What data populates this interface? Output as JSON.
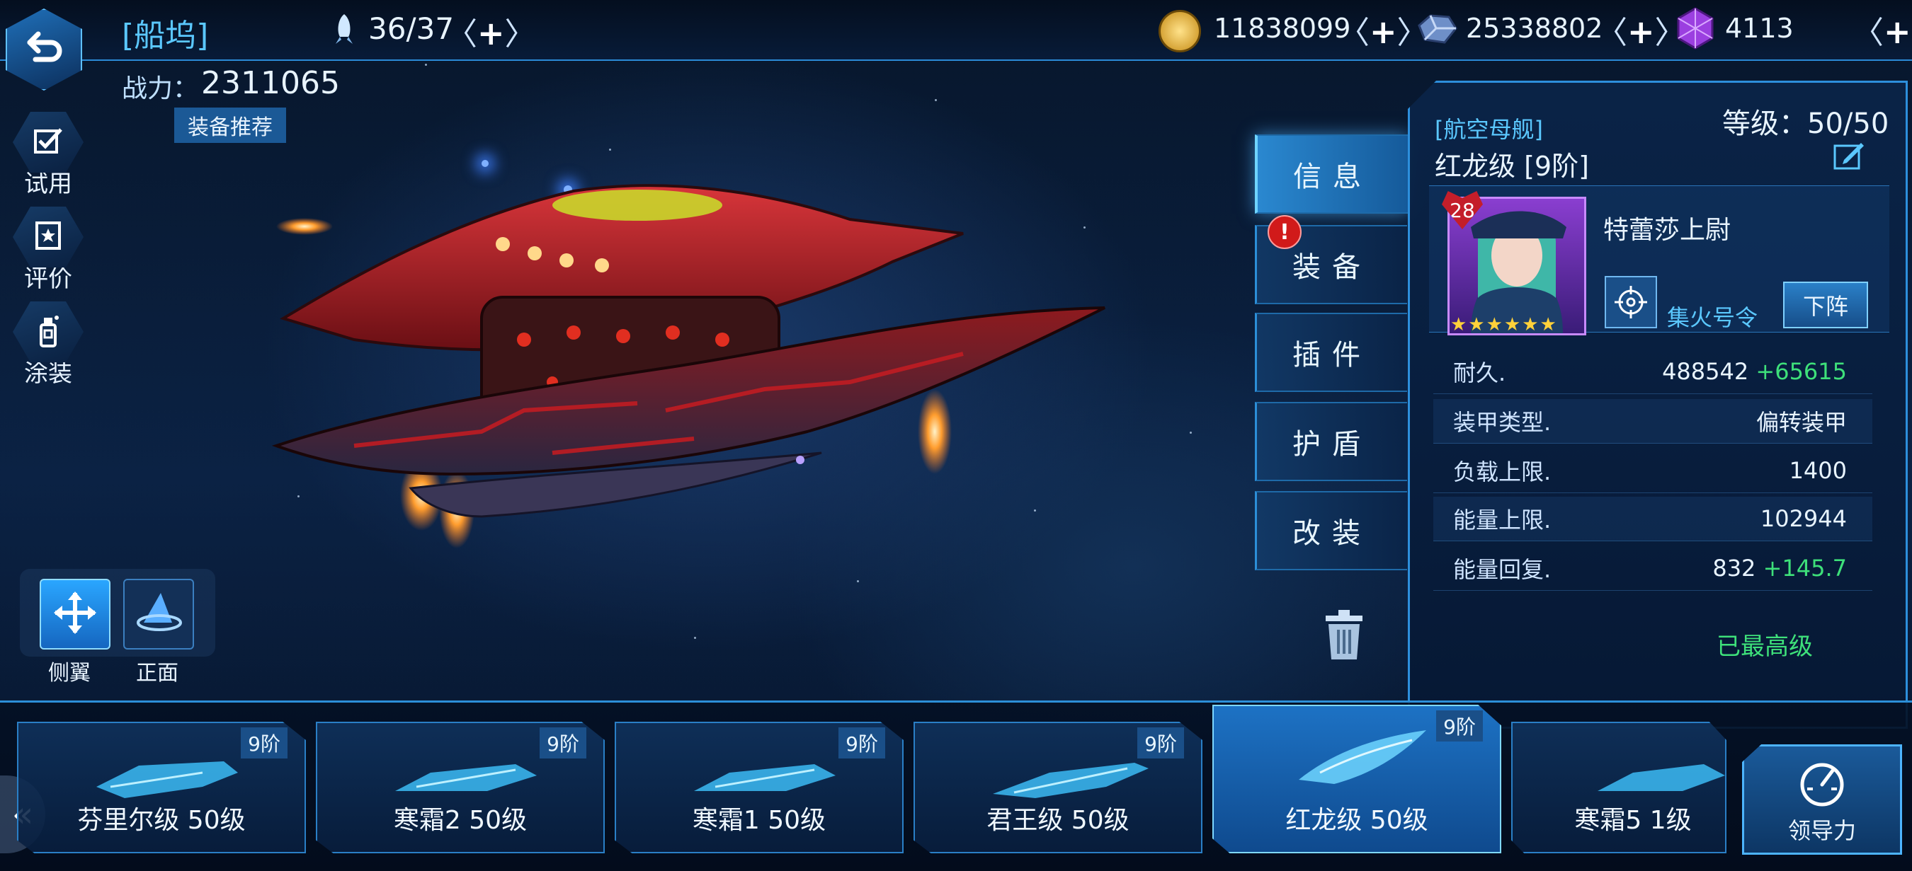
{
  "header": {
    "title": "[船坞]",
    "fleet_count": "36/37",
    "power_label": "战力：",
    "power_value": "2311065",
    "recommend_label": "装备推荐",
    "resources": [
      {
        "icon": "gold-coin-icon",
        "value": "11838099"
      },
      {
        "icon": "metal-ore-icon",
        "value": "25338802"
      },
      {
        "icon": "crystal-icon",
        "value": "4113"
      }
    ]
  },
  "sidebar": {
    "items": [
      {
        "icon": "checkbox-icon",
        "label": "试用"
      },
      {
        "icon": "rating-icon",
        "label": "评价"
      },
      {
        "icon": "paint-spray-icon",
        "label": "涂装"
      }
    ]
  },
  "view": {
    "side_label": "侧翼",
    "front_label": "正面"
  },
  "tabs": [
    {
      "label": "信息",
      "active": true
    },
    {
      "label": "装备",
      "alert": "!"
    },
    {
      "label": "插件"
    },
    {
      "label": "护盾"
    },
    {
      "label": "改装"
    }
  ],
  "panel": {
    "ship_class": "[航空母舰]",
    "ship_name": "红龙级 [9阶]",
    "level_text": "等级：50/50",
    "captain": {
      "name": "特蕾莎上尉",
      "level": "28",
      "stars": 6,
      "skill": "集火号令",
      "unassign_label": "下阵"
    },
    "stats": [
      {
        "label": "耐久.",
        "value": "488542",
        "bonus": "+65615"
      },
      {
        "label": "装甲类型.",
        "value": "偏转装甲",
        "bonus": ""
      },
      {
        "label": "负载上限.",
        "value": "1400",
        "bonus": ""
      },
      {
        "label": "能量上限.",
        "value": "102944",
        "bonus": ""
      },
      {
        "label": "能量回复.",
        "value": "832",
        "bonus": "+145.7"
      }
    ],
    "max_level_text": "已最高级"
  },
  "ships": [
    {
      "name": "芬里尔级 50级",
      "tier": "9阶"
    },
    {
      "name": "寒霜2 50级",
      "tier": "9阶"
    },
    {
      "name": "寒霜1 50级",
      "tier": "9阶"
    },
    {
      "name": "君王级 50级",
      "tier": "9阶"
    },
    {
      "name": "红龙级 50级",
      "tier": "9阶",
      "active": true
    },
    {
      "name": "寒霜5 1级",
      "tier": ""
    }
  ],
  "leader_label": "领导力",
  "colors": {
    "accent": "#2c8fd8",
    "highlight": "#5bc8ff",
    "bonus_green": "#3ee07a",
    "ship_red": "#a81f22"
  }
}
